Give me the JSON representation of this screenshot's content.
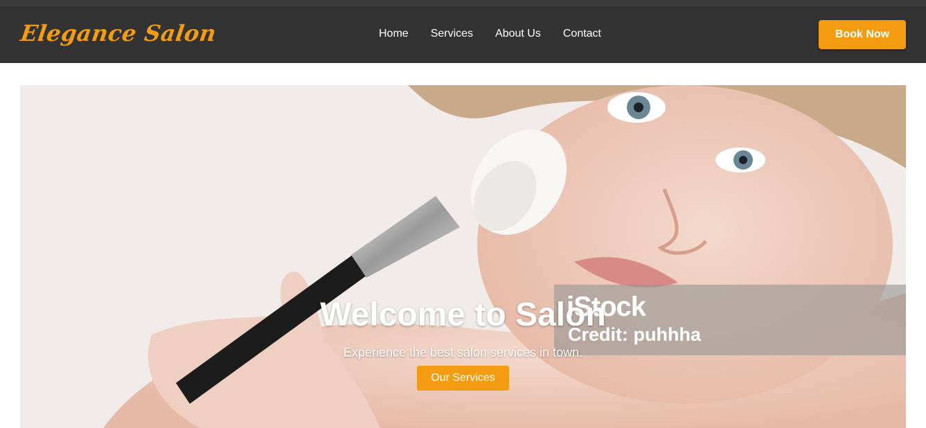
{
  "brand": {
    "name": "Elegance Salon"
  },
  "nav": {
    "links": [
      {
        "label": "Home"
      },
      {
        "label": "Services"
      },
      {
        "label": "About Us"
      },
      {
        "label": "Contact"
      }
    ],
    "cta_label": "Book Now"
  },
  "hero": {
    "title": "Welcome to Salon",
    "subtitle": "Experience the best salon services in town.",
    "button_label": "Our Services",
    "watermark": {
      "logo": "iStock",
      "credit": "Credit: puhhha"
    }
  },
  "colors": {
    "accent": "#f39c12",
    "navbar": "#333333"
  }
}
